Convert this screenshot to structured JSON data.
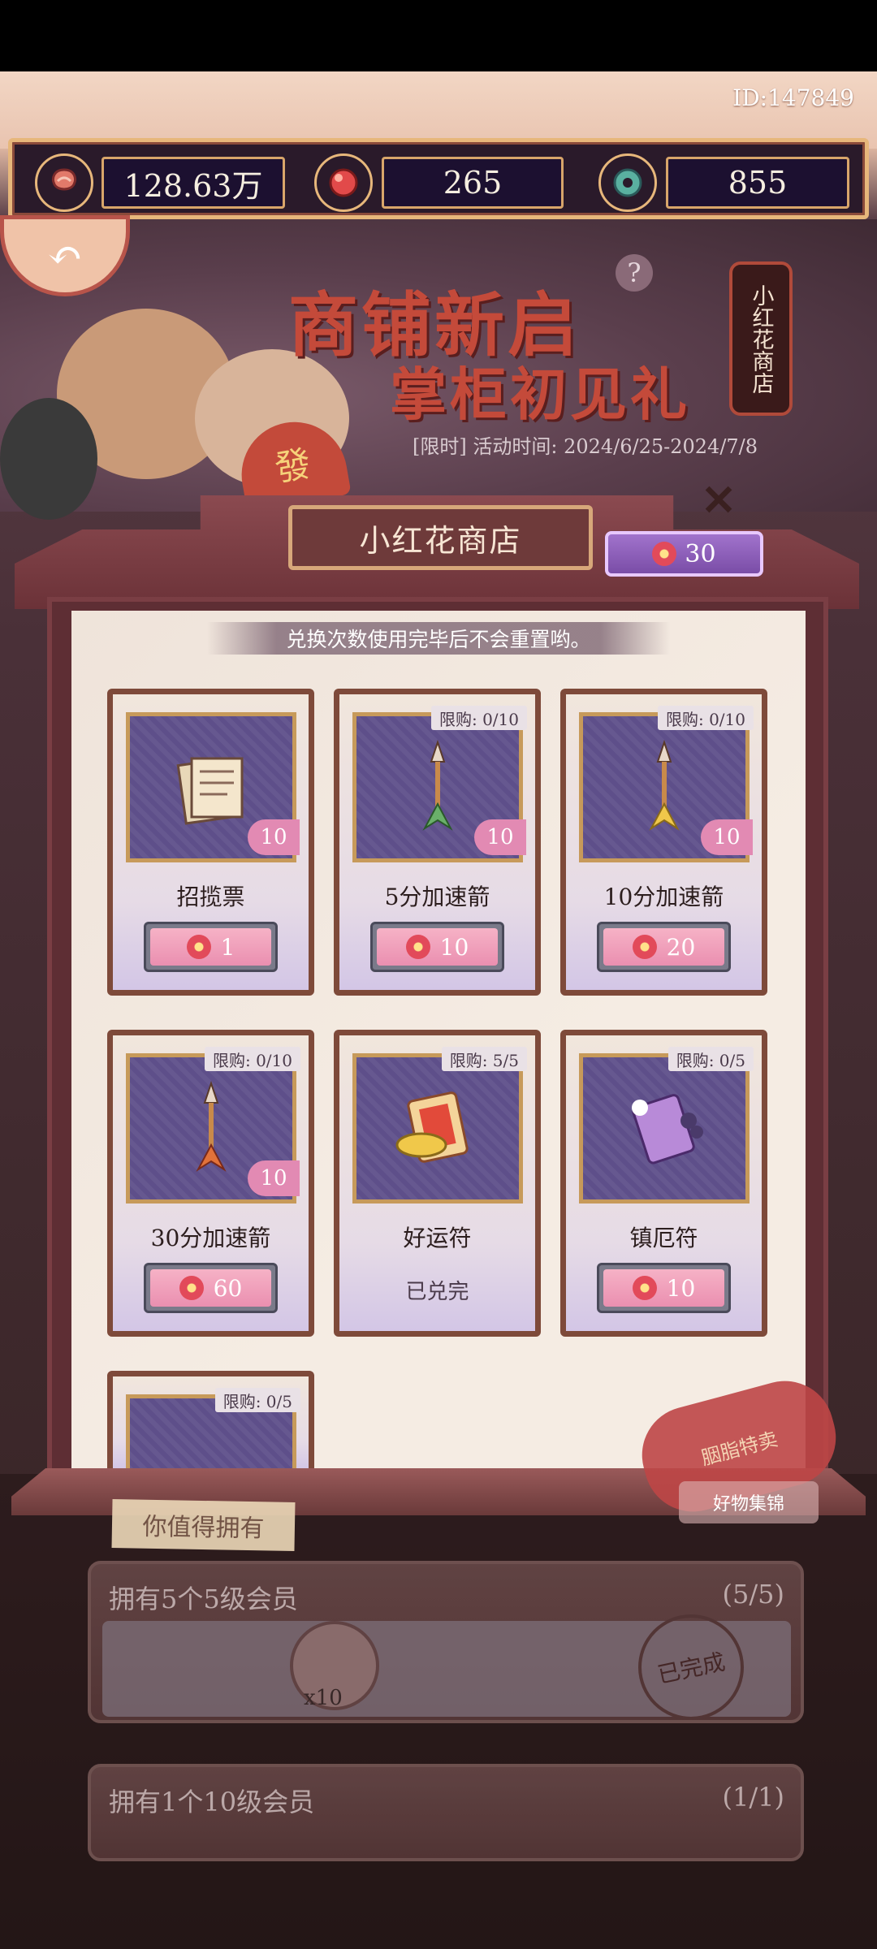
{
  "header": {
    "id_label": "ID:147849"
  },
  "resources": {
    "coins": "128.63万",
    "gems": "265",
    "jade": "855"
  },
  "banner": {
    "title_line1": "商铺新启",
    "title_line2": "掌柜初见礼",
    "period": "[限时] 活动时间: 2024/6/25-2024/7/8",
    "lantern_label": "小红花商店",
    "question_mark": "?"
  },
  "shop": {
    "name": "小红花商店",
    "balance": "30",
    "notice": "兑换次数使用完毕后不会重置哟。",
    "items": [
      {
        "name": "招揽票",
        "qty": "10",
        "limit": "",
        "price": "1",
        "sold_out": ""
      },
      {
        "name": "5分加速箭",
        "qty": "10",
        "limit": "限购: 0/10",
        "price": "10",
        "sold_out": ""
      },
      {
        "name": "10分加速箭",
        "qty": "10",
        "limit": "限购: 0/10",
        "price": "20",
        "sold_out": ""
      },
      {
        "name": "30分加速箭",
        "qty": "10",
        "limit": "限购: 0/10",
        "price": "60",
        "sold_out": ""
      },
      {
        "name": "好运符",
        "qty": "",
        "limit": "限购: 5/5",
        "price": "",
        "sold_out": "已兑完"
      },
      {
        "name": "镇厄符",
        "qty": "",
        "limit": "限购: 0/5",
        "price": "10",
        "sold_out": ""
      },
      {
        "name": "",
        "qty": "",
        "limit": "限购: 0/5",
        "price": "",
        "sold_out": ""
      }
    ]
  },
  "decor": {
    "tape_label": "你值得拥有",
    "stamp_label": "胭脂特卖",
    "goods_label": "好物集锦",
    "x_label": "x10",
    "fan_char": "發"
  },
  "tasks": [
    {
      "label": "拥有5个5级会员",
      "count": "(5/5)",
      "times": "x10",
      "status": "已完成"
    },
    {
      "label": "拥有1个10级会员",
      "count": "(1/1)"
    }
  ],
  "colors": {
    "accent_pink": "#ea8fb0",
    "frame_brown": "#7e4a3a",
    "item_bg_purple": "#5e4f8a",
    "title_red": "#c44a3a"
  }
}
